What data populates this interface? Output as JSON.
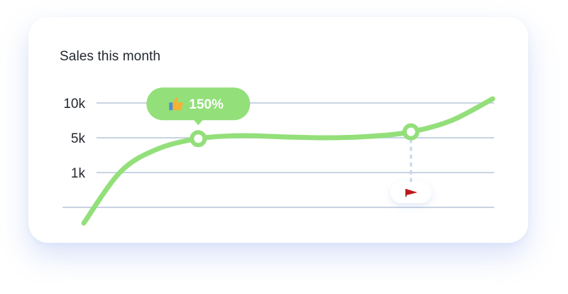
{
  "chart_data": {
    "type": "line",
    "title": "Sales this month",
    "y_tick_labels": [
      "10k",
      "5k",
      "1k"
    ],
    "y_ticks": [
      10000,
      5000,
      1000
    ],
    "grid": true,
    "series": [
      {
        "color": "#93df7a",
        "points": [
          {
            "x": 0.0,
            "y": -450
          },
          {
            "x": 0.09,
            "y": 1100
          },
          {
            "x": 0.18,
            "y": 3700
          },
          {
            "x": 0.28,
            "y": 4900
          },
          {
            "x": 0.38,
            "y": 5300
          },
          {
            "x": 0.5,
            "y": 5100
          },
          {
            "x": 0.6,
            "y": 5000
          },
          {
            "x": 0.7,
            "y": 5200
          },
          {
            "x": 0.8,
            "y": 5850
          },
          {
            "x": 0.9,
            "y": 7500
          },
          {
            "x": 1.0,
            "y": 10600
          }
        ]
      }
    ],
    "annotations": [
      {
        "x": 0.28,
        "y": 4900,
        "label": "150%",
        "icon": "thumbs-up-icon",
        "color": "#93df7a"
      },
      {
        "x": 0.8,
        "y": 5850,
        "icon": "red-flag-icon",
        "color": "#c0171a"
      }
    ],
    "colors": {
      "line": "#93df7a",
      "grid": "#c8d4e3",
      "guide": "#c8d6ea",
      "flag": "#c0171a",
      "tooltip_text": "#ffffff",
      "thumb": "#f2b233"
    }
  }
}
